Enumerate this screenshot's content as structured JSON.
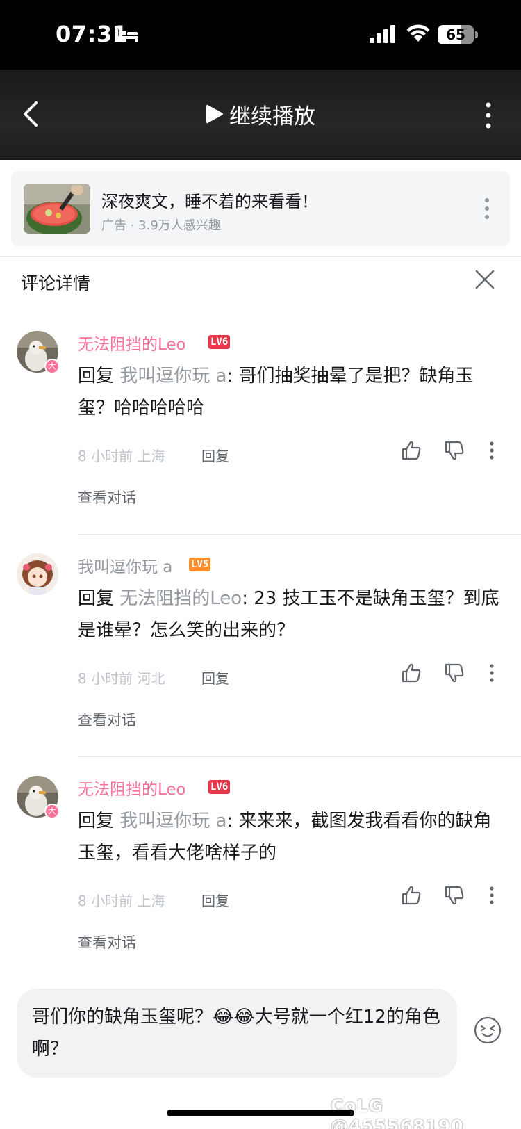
{
  "status_bar": {
    "time": "07:31",
    "battery": "65",
    "battery_fraction": 0.65
  },
  "header": {
    "continue_label": "继续播放"
  },
  "ad": {
    "title": "深夜爽文，睡不着的来看看！",
    "subtitle": "广告 · 3.9万人感兴趣"
  },
  "panel": {
    "title": "评论详情"
  },
  "comments": [
    {
      "username": "无法阻挡的Leo",
      "level": "LV6",
      "reply_prefix": "回复 ",
      "reply_to": "我叫逗你玩 a",
      "text": ": 哥们抽奖抽晕了是把？缺角玉玺？哈哈哈哈哈",
      "meta": "8 小时前  上海",
      "reply_label": "回复",
      "view_conversation": "查看对话",
      "badge": "大"
    },
    {
      "username": "我叫逗你玩 a",
      "level": "LV5",
      "reply_prefix": "回复 ",
      "reply_to": "无法阻挡的Leo",
      "text": ": 23 技工玉不是缺角玉玺？到底是谁晕？怎么笑的出来的？",
      "meta": "8 小时前  河北",
      "reply_label": "回复",
      "view_conversation": "查看对话"
    },
    {
      "username": "无法阻挡的Leo",
      "level": "LV6",
      "reply_prefix": "回复 ",
      "reply_to": "我叫逗你玩 a",
      "text": ": 来来来，截图发我看看你的缺角玉玺，看看大佬啥样子的",
      "meta": "8 小时前  上海",
      "reply_label": "回复",
      "view_conversation": "查看对话",
      "badge": "大"
    }
  ],
  "input": {
    "text": "哥们你的缺角玉玺呢？😂😂大号就一个红12的角色啊？"
  },
  "watermark": "CoLG @455568190",
  "colors": {
    "pink": "#fb7299",
    "gray": "#9499a0",
    "lv6": "#e8364a",
    "lv5": "#ff8e2b"
  }
}
